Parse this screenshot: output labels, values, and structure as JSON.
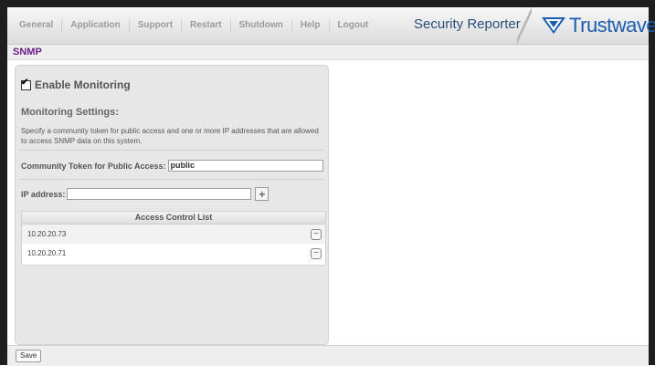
{
  "nav": {
    "items": [
      "General",
      "Application",
      "Support",
      "Restart",
      "Shutdown",
      "Help",
      "Logout"
    ]
  },
  "brand": {
    "product_name": "Security Reporter",
    "company": "Trustwave",
    "registered": "®",
    "logo_icon": "trustwave-logo-icon",
    "accent_color": "#1c5cb1"
  },
  "page": {
    "title": "SNMP",
    "title_color": "#6a1f8a"
  },
  "monitoring": {
    "enable_label": "Enable Monitoring",
    "enabled": true,
    "section_title": "Monitoring Settings:",
    "description": "Specify a community token for public access and one or more IP addresses that are allowed to access SNMP data on this system.",
    "token_label": "Community Token for Public Access:",
    "token_value": "public",
    "ip_label": "IP address:",
    "ip_value": ""
  },
  "acl": {
    "header": "Access Control List",
    "rows": [
      {
        "ip": "10.20.20.73"
      },
      {
        "ip": "10.20.20.71"
      }
    ]
  },
  "footer": {
    "save_label": "Save"
  }
}
